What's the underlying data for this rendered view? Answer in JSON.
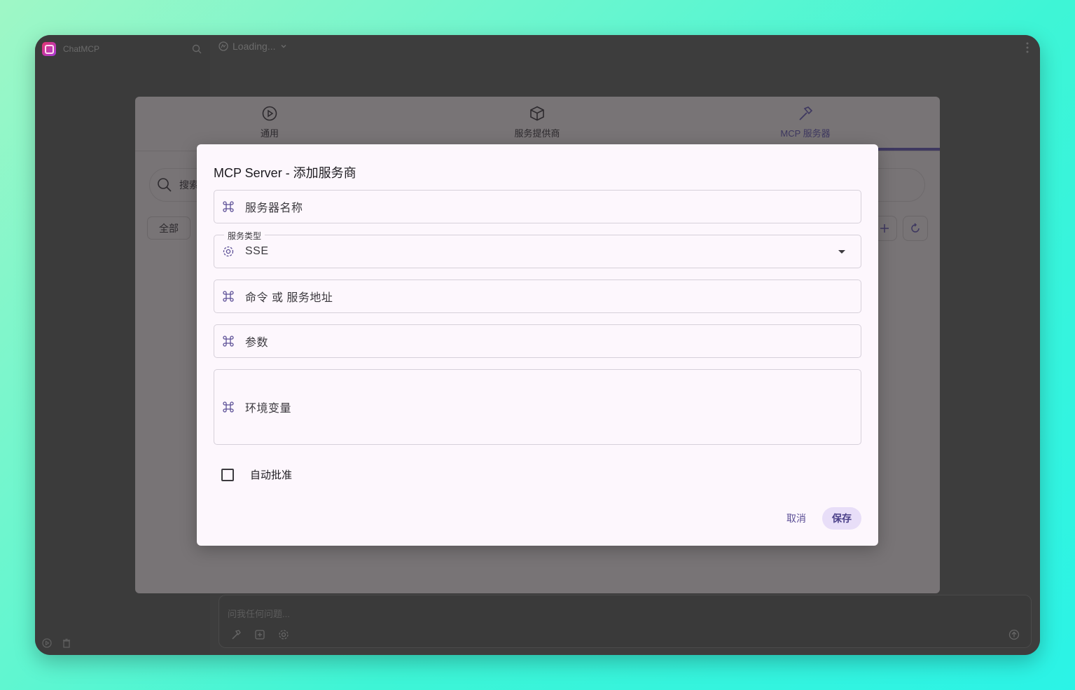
{
  "app": {
    "name": "ChatMCP",
    "model_selector": "Loading...",
    "composer_placeholder": "问我任何问题..."
  },
  "settings": {
    "tabs": [
      {
        "label": "通用",
        "icon": "general-icon"
      },
      {
        "label": "服务提供商",
        "icon": "box-icon"
      },
      {
        "label": "MCP 服务器",
        "icon": "hammer-icon",
        "active": true
      }
    ],
    "search_placeholder": "搜索",
    "filter_all": "全部"
  },
  "dialog": {
    "title": "MCP Server - 添加服务商",
    "fields": {
      "server_name": "服务器名称",
      "service_type_label": "服务类型",
      "service_type_value": "SSE",
      "command": "命令 或 服务地址",
      "args": "参数",
      "env": "环境变量"
    },
    "auto_approve": "自动批准",
    "cancel": "取消",
    "save": "保存"
  },
  "colors": {
    "accent": "#5c4f96",
    "dialog_bg": "#fdf7fd",
    "save_bg": "#e8def8"
  }
}
